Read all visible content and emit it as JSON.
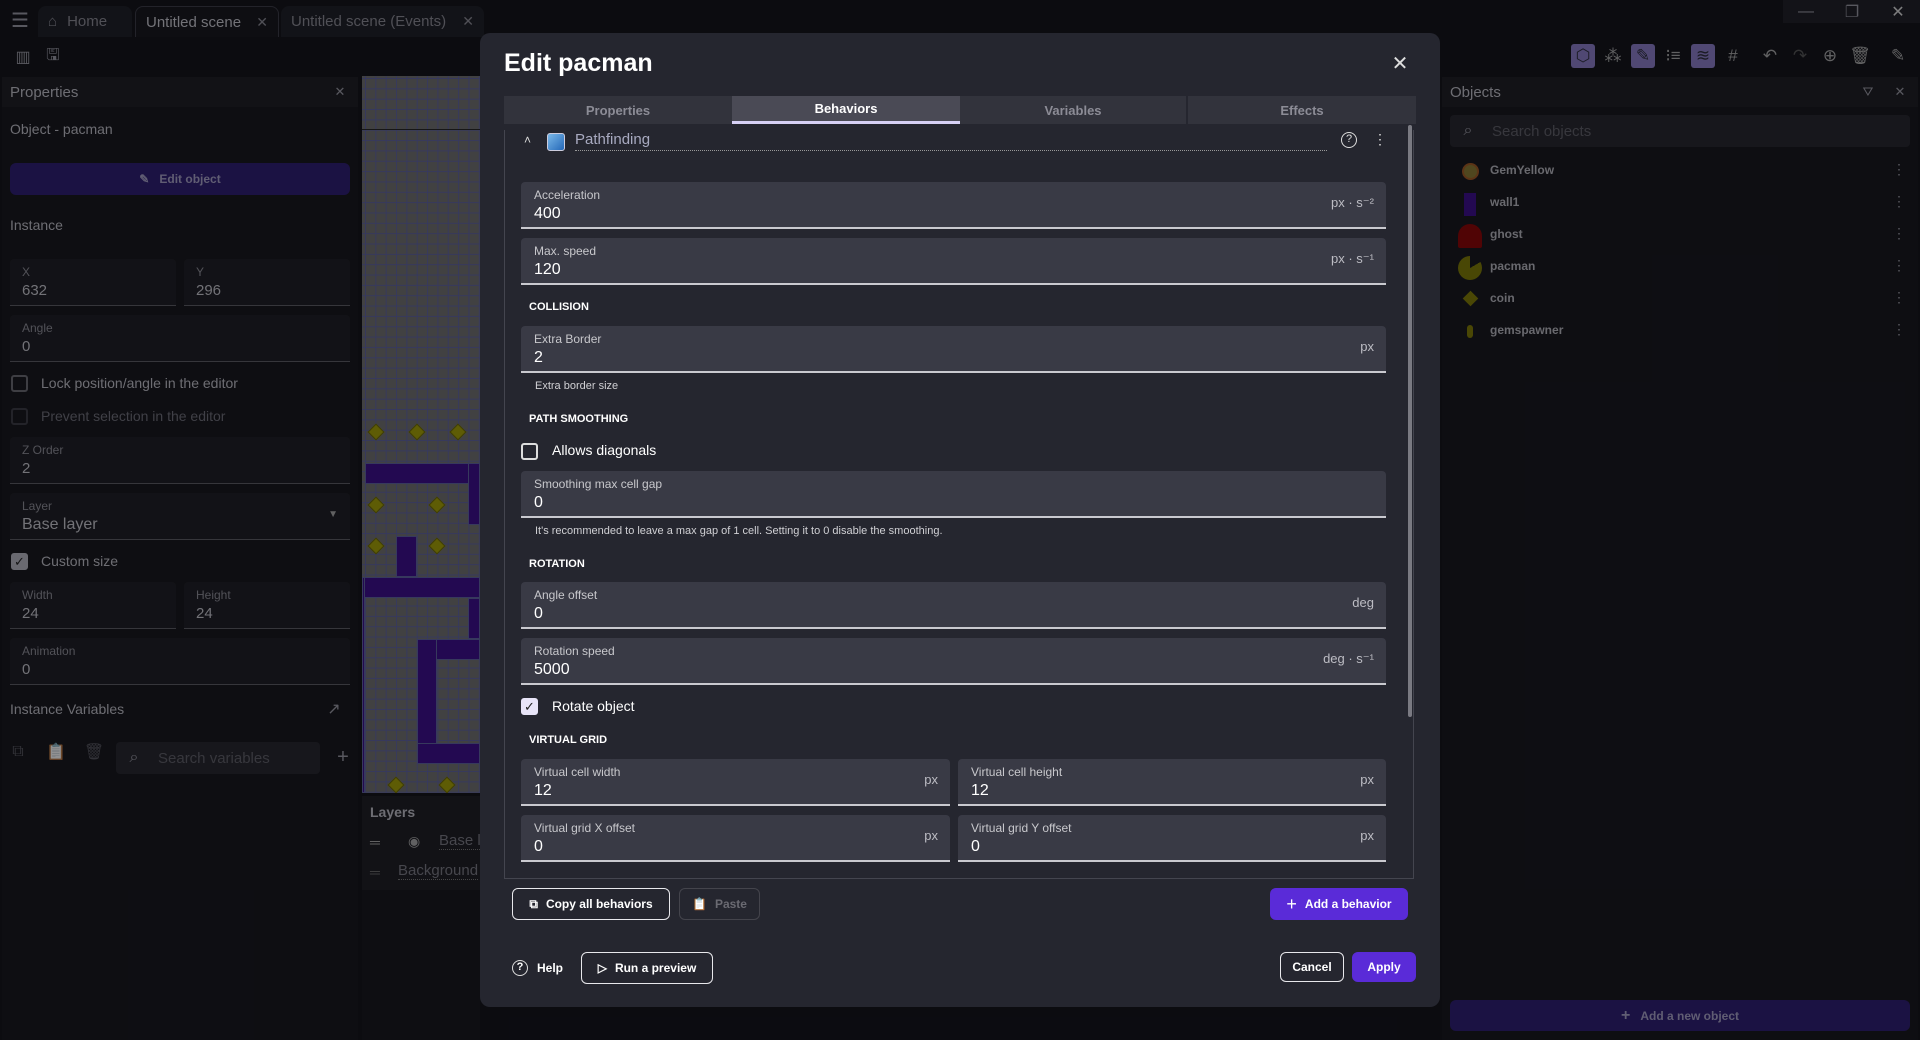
{
  "tabs": [
    {
      "label": "Home"
    },
    {
      "label": "Untitled scene"
    },
    {
      "label": "Untitled scene (Events)"
    }
  ],
  "properties": {
    "title": "Properties",
    "object_label": "Object  - pacman",
    "edit_object": "Edit object",
    "instance": "Instance",
    "x": {
      "label": "X",
      "value": "632"
    },
    "y": {
      "label": "Y",
      "value": "296"
    },
    "angle": {
      "label": "Angle",
      "value": "0"
    },
    "lock": {
      "label": "Lock position/angle in the editor",
      "checked": false
    },
    "prevent": {
      "label": "Prevent selection in the editor",
      "checked": false
    },
    "zorder": {
      "label": "Z Order",
      "value": "2"
    },
    "layer": {
      "label": "Layer",
      "value": "Base layer"
    },
    "custom_size": {
      "label": "Custom size",
      "checked": true
    },
    "width": {
      "label": "Width",
      "value": "24"
    },
    "height": {
      "label": "Height",
      "value": "24"
    },
    "animation": {
      "label": "Animation",
      "value": "0"
    },
    "instance_variables": "Instance Variables",
    "search_variables_placeholder": "Search variables"
  },
  "layers": {
    "title": "Layers",
    "items": [
      "Base layer",
      "Background"
    ]
  },
  "objects": {
    "title": "Objects",
    "search_placeholder": "Search objects",
    "items": [
      {
        "name": "GemYellow"
      },
      {
        "name": "wall1"
      },
      {
        "name": "ghost"
      },
      {
        "name": "pacman"
      },
      {
        "name": "coin"
      },
      {
        "name": "gemspawner"
      }
    ],
    "add_new": "Add a new object"
  },
  "dialog": {
    "title": "Edit pacman",
    "tabs": [
      "Properties",
      "Behaviors",
      "Variables",
      "Effects"
    ],
    "active_tab": "Behaviors",
    "behavior_name": "Pathfinding",
    "fields": {
      "acceleration": {
        "label": "Acceleration",
        "value": "400",
        "unit": "px · s⁻²"
      },
      "max_speed": {
        "label": "Max. speed",
        "value": "120",
        "unit": "px · s⁻¹"
      },
      "extra_border": {
        "label": "Extra Border",
        "value": "2",
        "unit": "px",
        "help": "Extra border size"
      },
      "smoothing": {
        "label": "Smoothing max cell gap",
        "value": "0",
        "help": "It's recommended to leave a max gap of 1 cell. Setting it to 0 disable the smoothing."
      },
      "angle_offset": {
        "label": "Angle offset",
        "value": "0",
        "unit": "deg"
      },
      "rotation_speed": {
        "label": "Rotation speed",
        "value": "5000",
        "unit": "deg · s⁻¹"
      },
      "cell_width": {
        "label": "Virtual cell width",
        "value": "12",
        "unit": "px"
      },
      "cell_height": {
        "label": "Virtual cell height",
        "value": "12",
        "unit": "px"
      },
      "grid_x": {
        "label": "Virtual grid X offset",
        "value": "0",
        "unit": "px"
      },
      "grid_y": {
        "label": "Virtual grid Y offset",
        "value": "0",
        "unit": "px"
      }
    },
    "sections": {
      "collision": "COLLISION",
      "path_smoothing": "PATH SMOOTHING",
      "rotation": "ROTATION",
      "virtual_grid": "VIRTUAL GRID"
    },
    "allows_diagonals": {
      "label": "Allows diagonals",
      "checked": false
    },
    "rotate_object": {
      "label": "Rotate object",
      "checked": true
    },
    "copy_all": "Copy all behaviors",
    "paste": "Paste",
    "add_behavior": "Add a behavior",
    "help": "Help",
    "run_preview": "Run a preview",
    "cancel": "Cancel",
    "apply": "Apply"
  },
  "colors": {
    "accent": "#5a2bd8",
    "wall": "#3a0a8a",
    "coin": "#a4a000"
  }
}
